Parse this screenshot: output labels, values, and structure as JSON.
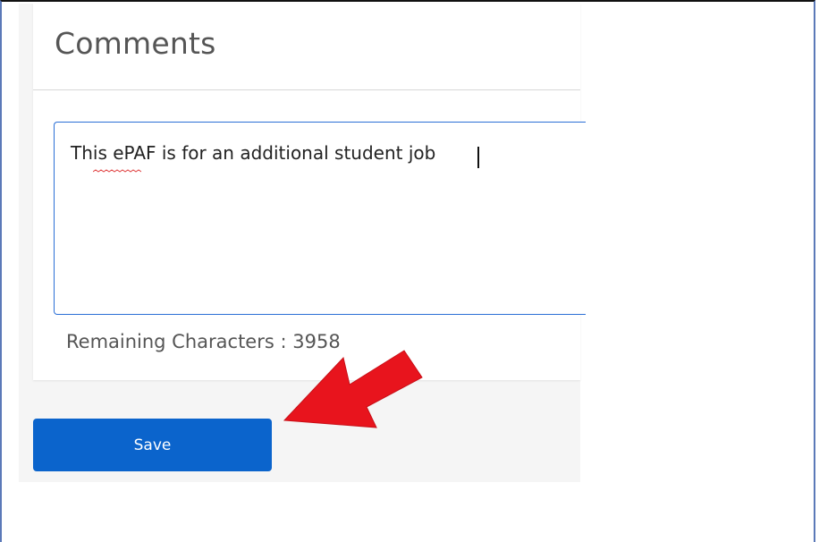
{
  "comments": {
    "title": "Comments",
    "textarea_value": "This ePAF is for an additional student job",
    "remaining_label": "Remaining Characters : 3958"
  },
  "actions": {
    "save_label": "Save"
  },
  "annotation": {
    "arrow_icon": "red-arrow-icon",
    "arrow_color": "#e8141d"
  },
  "colors": {
    "accent": "#0b64cc",
    "focus_border": "#2b6fd6"
  }
}
